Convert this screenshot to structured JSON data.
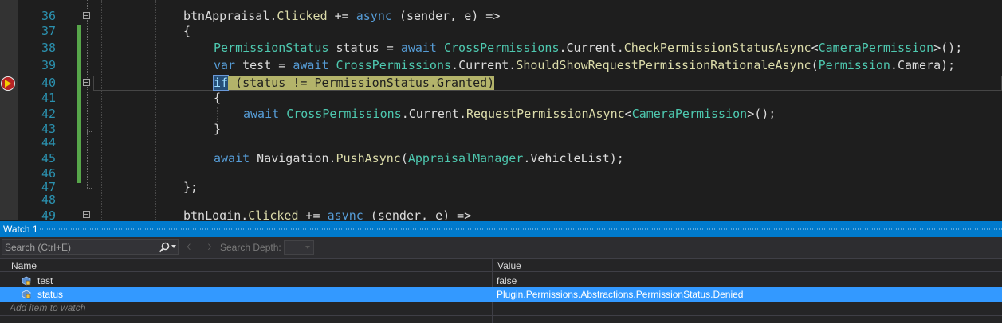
{
  "editor": {
    "line_numbers": [
      "36",
      "37",
      "38",
      "39",
      "40",
      "41",
      "42",
      "43",
      "44",
      "45",
      "46",
      "47",
      "48",
      "49"
    ],
    "code": {
      "l36": {
        "a": "btnAppraisal.",
        "b": "Clicked",
        "c": " += ",
        "d": "async",
        "e": " (sender, e) =>"
      },
      "l37": {
        "a": "{"
      },
      "l38": {
        "a": "PermissionStatus",
        "b": " status = ",
        "c": "await",
        "d": " ",
        "e": "CrossPermissions",
        ".f": "",
        "f": ".",
        "g": "Current",
        ".h": "",
        "h": ".",
        "i": "CheckPermissionStatusAsync",
        "j": "<",
        "k": "CameraPermission",
        "l": ">();"
      },
      "l39": {
        "a": "var",
        "b": " test = ",
        "c": "await",
        "d": " ",
        "e": "CrossPermissions",
        "f": ".",
        "g": "Current",
        "h": ".",
        "i": "ShouldShowRequestPermissionRationaleAsync",
        "j": "(",
        "k": "Permission",
        "l": ".Camera);"
      },
      "l40": {
        "a": "if",
        "b": " (status != ",
        "c": "PermissionStatus",
        "d": ".Granted)"
      },
      "l41": {
        "a": "{"
      },
      "l42": {
        "a": "await",
        "b": " ",
        "c": "CrossPermissions",
        "d": ".",
        "e": "Current",
        "f": ".",
        "g": "RequestPermissionAsync",
        "h": "<",
        "i": "CameraPermission",
        "j": ">();"
      },
      "l43": {
        "a": "}"
      },
      "l45": {
        "a": "await",
        "b": " Navigation.",
        "c": "PushAsync",
        "d": "(",
        "e": "AppraisalManager",
        "f": ".VehicleList);"
      },
      "l47": {
        "a": "};"
      },
      "l49": {
        "a": "btnLogin.",
        "b": "Clicked",
        "c": " += ",
        "d": "async",
        "e": " (sender, e) =>"
      }
    }
  },
  "watch": {
    "title": "Watch 1",
    "search_placeholder": "Search (Ctrl+E)",
    "search_depth_label": "Search Depth:",
    "columns": {
      "name": "Name",
      "value": "Value"
    },
    "rows": [
      {
        "name": "test",
        "value": "false",
        "icon": "field-icon"
      },
      {
        "name": "status",
        "value": "Plugin.Permissions.Abstractions.PermissionStatus.Denied",
        "icon": "field-icon"
      }
    ],
    "add_item_placeholder": "Add item to watch"
  },
  "colors": {
    "accent": "#007acc",
    "selection": "#3399ff",
    "statement_highlight": "#b3b36a",
    "line_numbers": "#2b91af"
  }
}
